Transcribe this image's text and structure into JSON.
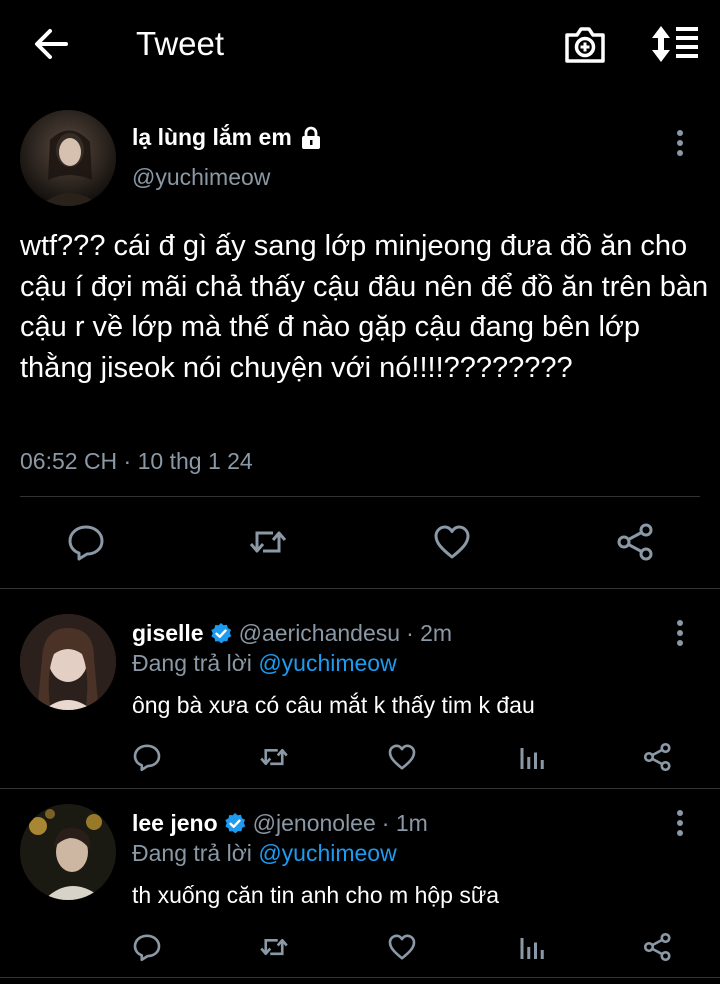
{
  "header": {
    "title": "Tweet"
  },
  "main_tweet": {
    "name": "lạ lùng lắm em",
    "handle": "@yuchimeow",
    "text": "wtf??? cái đ gì ấy sang lớp minjeong đưa đồ ăn cho cậu í đợi mãi chả thấy cậu đâu nên để đồ ăn trên bàn cậu r về lớp mà thế đ nào gặp cậu đang bên lớp thằng jiseok nói chuyện với nó!!!!????????",
    "timestamp": "06:52 CH · 10 thg 1 24"
  },
  "replies": [
    {
      "name": "giselle",
      "handle": "@aerichandesu",
      "time": "· 2m",
      "replying_label": "Đang trả lời",
      "replying_to": "@yuchimeow",
      "text": "ông bà xưa có câu mắt k thấy tim k đau"
    },
    {
      "name": "lee jeno",
      "handle": "@jenonolee",
      "time": "· 1m",
      "replying_label": "Đang trả lời",
      "replying_to": "@yuchimeow",
      "text": "th xuống căn tin anh cho m hộp sữa"
    }
  ],
  "colors": {
    "background": "#000000",
    "secondary_text": "#8b98a5",
    "accent": "#1d9bf0",
    "divider": "#2f3336"
  },
  "icons": [
    "back-arrow-icon",
    "camera-icon",
    "sort-icon",
    "lock-icon",
    "more-icon",
    "reply-icon",
    "retweet-icon",
    "like-icon",
    "share-icon",
    "verified-icon",
    "analytics-icon"
  ]
}
